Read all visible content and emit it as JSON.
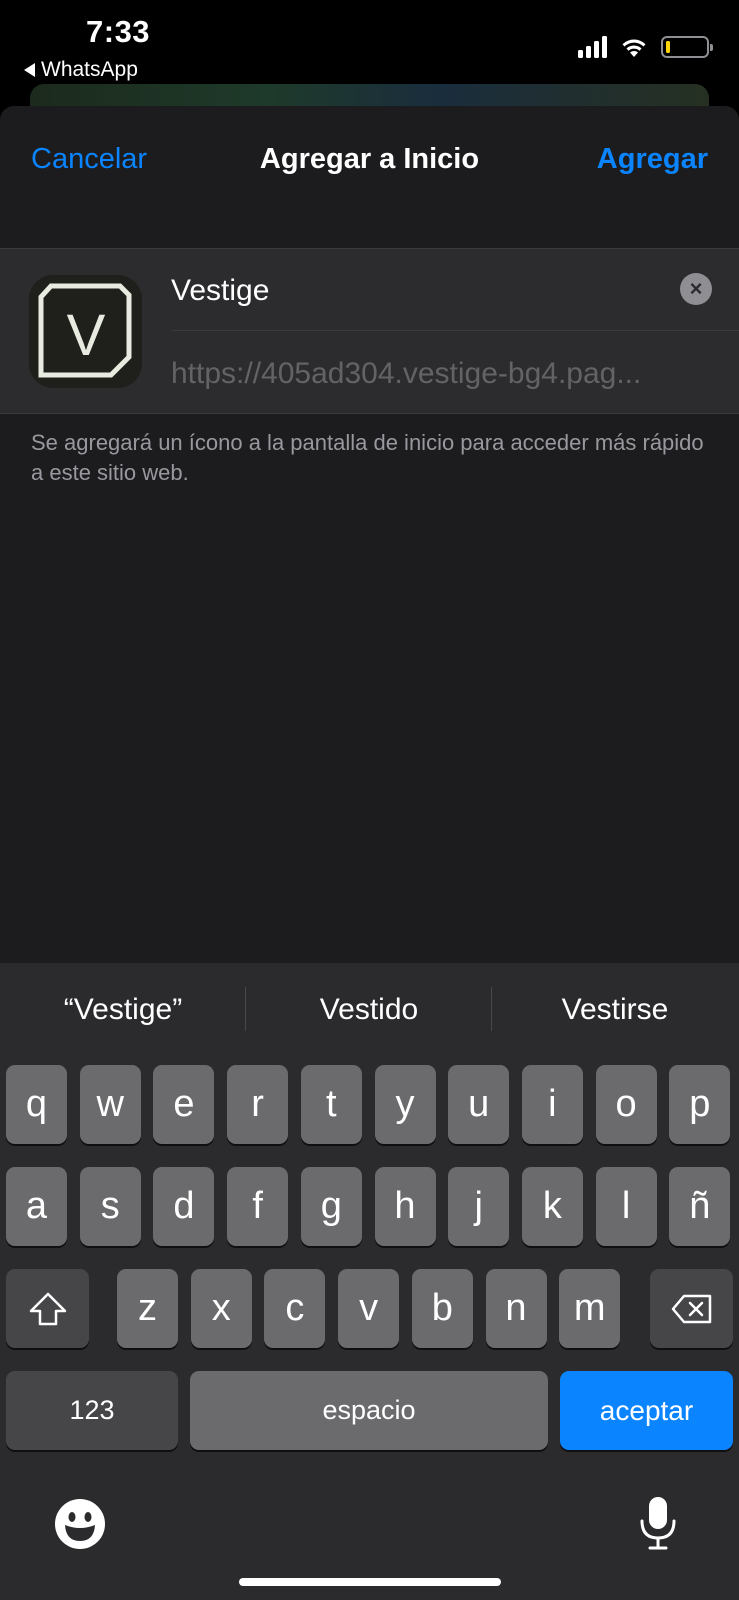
{
  "status_bar": {
    "time": "7:33",
    "back_app": "WhatsApp",
    "battery_color": "#ffd60a"
  },
  "nav": {
    "cancel_label": "Cancelar",
    "title": "Agregar a Inicio",
    "add_label": "Agregar"
  },
  "form": {
    "app_icon_letter": "V",
    "name_value": "Vestige",
    "url": "https://405ad304.vestige-bg4.pag..."
  },
  "footnote": "Se agregará un ícono a la pantalla de inicio para acceder más rápido a este sitio web.",
  "keyboard": {
    "suggestions": [
      "“Vestige”",
      "Vestido",
      "Vestirse"
    ],
    "row1": [
      "q",
      "w",
      "e",
      "r",
      "t",
      "y",
      "u",
      "i",
      "o",
      "p"
    ],
    "row2": [
      "a",
      "s",
      "d",
      "f",
      "g",
      "h",
      "j",
      "k",
      "l",
      "ñ"
    ],
    "row3": [
      "z",
      "x",
      "c",
      "v",
      "b",
      "n",
      "m"
    ],
    "numbers_label": "123",
    "space_label": "espacio",
    "return_label": "aceptar",
    "icons": [
      "shift-icon",
      "delete-icon",
      "emoji-icon",
      "microphone-icon"
    ]
  },
  "colors": {
    "accent": "#0a84ff",
    "sheet_bg": "#1c1c1e",
    "keyboard_bg": "#2b2b2d"
  }
}
